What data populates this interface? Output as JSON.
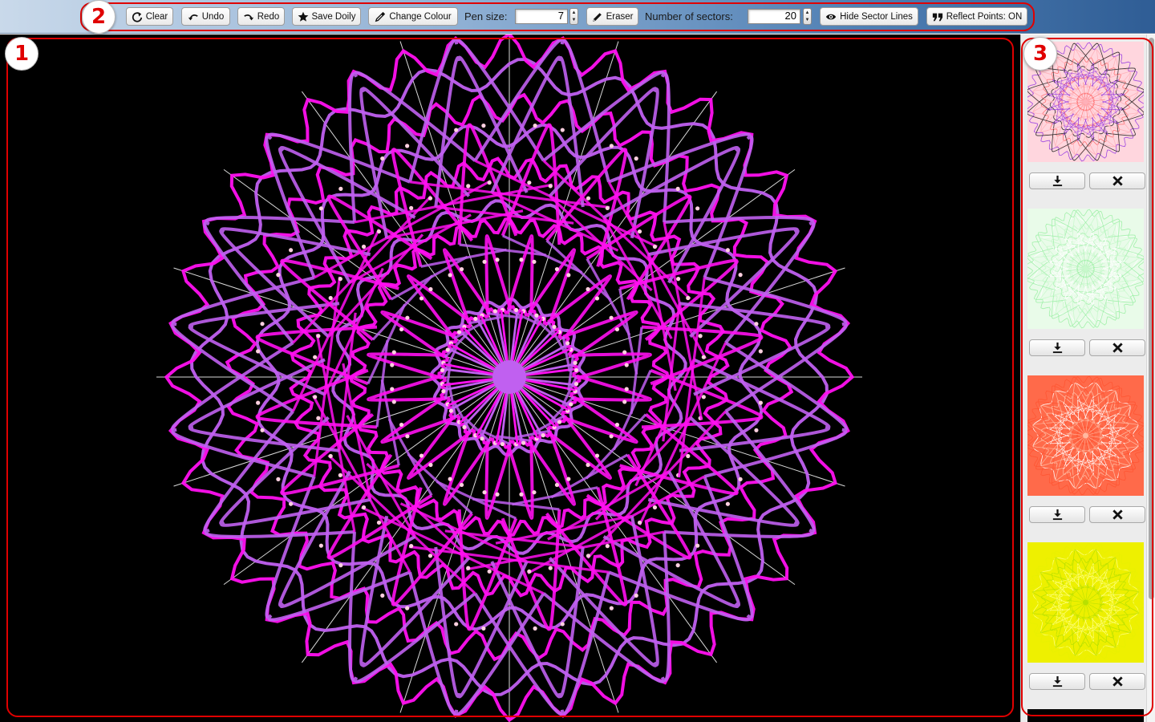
{
  "toolbar": {
    "clear_label": "Clear",
    "undo_label": "Undo",
    "redo_label": "Redo",
    "save_label": "Save Doily",
    "change_colour_label": "Change Colour",
    "pen_size_label": "Pen size:",
    "pen_size_value": "7",
    "eraser_label": "Eraser",
    "sectors_label": "Number of sectors:",
    "sectors_value": "20",
    "hide_sector_lines_label": "Hide Sector Lines",
    "reflect_points_label": "Reflect Points: ON"
  },
  "annotations": {
    "canvas": "1",
    "toolbar": "2",
    "gallery": "3"
  },
  "canvas": {
    "background": "#000000",
    "sectors": 20,
    "sector_line_color": "#ffffff",
    "pen_colors": [
      "#ff10f0",
      "#c060f0"
    ],
    "dot_color": "#ffd0e0"
  },
  "gallery": {
    "items": [
      {
        "name": "doily-pink",
        "bg": "#ffd6de",
        "colors": [
          "#ff7070",
          "#ffb0b8",
          "#9a40e0",
          "#222222"
        ]
      },
      {
        "name": "doily-green",
        "bg": "#e9fbe9",
        "colors": [
          "#9ff0a8",
          "#c8f8cc",
          "#ffffff"
        ]
      },
      {
        "name": "doily-orange",
        "bg": "#ff6a4a",
        "colors": [
          "#ff5533",
          "#ffb9a0",
          "#ffffff"
        ]
      },
      {
        "name": "doily-yellow",
        "bg": "#eef000",
        "colors": [
          "#e8f000",
          "#b8e000",
          "#ffff80"
        ]
      }
    ]
  }
}
